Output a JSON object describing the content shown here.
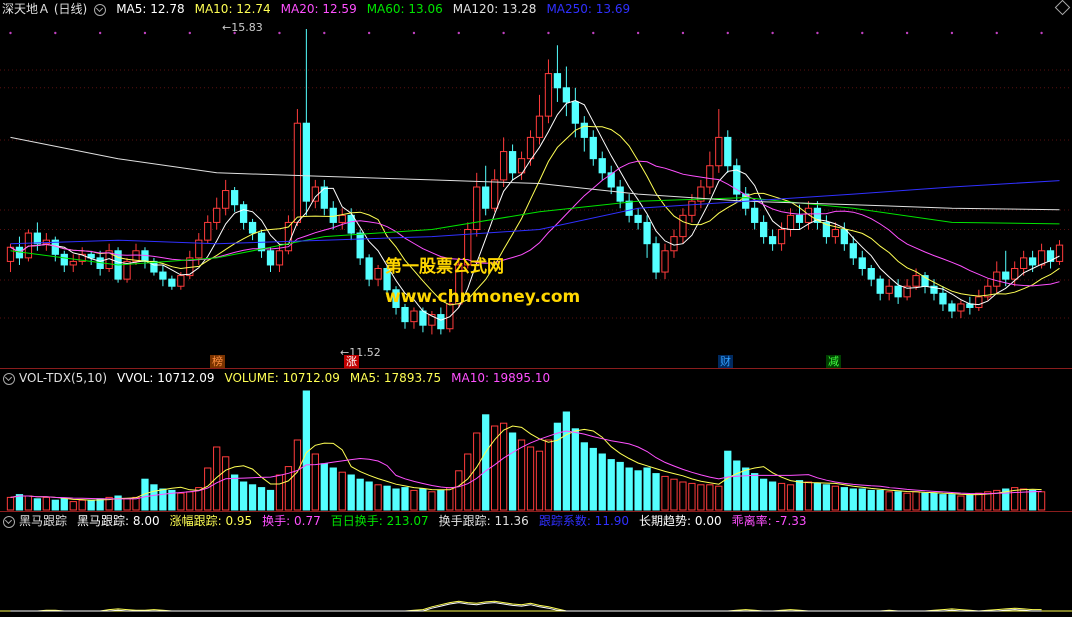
{
  "main": {
    "title": "深天地Ａ (日线)",
    "ma": [
      {
        "label": "MA5: 12.78",
        "color": "#ffffff"
      },
      {
        "label": "MA10: 12.74",
        "color": "#ffff54"
      },
      {
        "label": "MA20: 12.59",
        "color": "#ff50ff"
      },
      {
        "label": "MA60: 13.06",
        "color": "#00e400"
      },
      {
        "label": "MA120: 13.28",
        "color": "#e0e0e0"
      },
      {
        "label": "MA250: 13.69",
        "color": "#3030ff"
      }
    ],
    "high_label": "15.83",
    "low_label": "11.52",
    "watermark_line1": "第一股票公式网",
    "watermark_line2": "www.chnmoney.com",
    "markers": [
      {
        "text": "榜",
        "color": "#ff9040",
        "bg": "#7a3300"
      },
      {
        "text": "涨",
        "color": "#ffffff",
        "bg": "#c00000"
      },
      {
        "text": "财",
        "color": "#30a0ff",
        "bg": "#002a60"
      },
      {
        "text": "减",
        "color": "#40ff40",
        "bg": "#004000"
      }
    ]
  },
  "volume": {
    "title": "VOL-TDX(5,10)",
    "items": [
      {
        "label": "VVOL: 10712.09",
        "color": "#ffffff"
      },
      {
        "label": "VOLUME: 10712.09",
        "color": "#ffff54"
      },
      {
        "label": "MA5: 17893.75",
        "color": "#ffff54"
      },
      {
        "label": "MA10: 19895.10",
        "color": "#ff50ff"
      }
    ]
  },
  "indicator": {
    "title": "黑马跟踪",
    "items": [
      {
        "label": "黑马跟踪: 8.00",
        "color": "#ffffff"
      },
      {
        "label": "涨幅跟踪: 0.95",
        "color": "#ffff54"
      },
      {
        "label": "换手: 0.77",
        "color": "#ff50ff"
      },
      {
        "label": "百日换手: 213.07",
        "color": "#00e400"
      },
      {
        "label": "换手跟踪: 11.36",
        "color": "#e0e0e0"
      },
      {
        "label": "跟踪系数: 11.90",
        "color": "#3030ff"
      },
      {
        "label": "长期趋势: 0.00",
        "color": "#ffffff"
      },
      {
        "label": "乖离率: -7.33",
        "color": "#ff50ff"
      }
    ]
  },
  "chart_data": {
    "type": "candlestick",
    "price_range": [
      11.3,
      15.9
    ],
    "candles": [
      [
        12.55,
        12.75,
        12.4,
        12.8
      ],
      [
        12.75,
        12.6,
        12.5,
        12.9
      ],
      [
        12.6,
        12.95,
        12.55,
        13.0
      ],
      [
        12.95,
        12.8,
        12.7,
        13.1
      ],
      [
        12.8,
        12.85,
        12.7,
        12.95
      ],
      [
        12.85,
        12.65,
        12.55,
        12.9
      ],
      [
        12.65,
        12.5,
        12.4,
        12.7
      ],
      [
        12.5,
        12.55,
        12.4,
        12.65
      ],
      [
        12.55,
        12.65,
        12.5,
        12.75
      ],
      [
        12.65,
        12.6,
        12.5,
        12.7
      ],
      [
        12.6,
        12.45,
        12.35,
        12.7
      ],
      [
        12.45,
        12.7,
        12.4,
        12.8
      ],
      [
        12.7,
        12.3,
        12.25,
        12.75
      ],
      [
        12.3,
        12.55,
        12.25,
        12.6
      ],
      [
        12.55,
        12.7,
        12.5,
        12.8
      ],
      [
        12.7,
        12.55,
        12.45,
        12.75
      ],
      [
        12.55,
        12.4,
        12.35,
        12.6
      ],
      [
        12.4,
        12.3,
        12.2,
        12.5
      ],
      [
        12.3,
        12.2,
        12.15,
        12.35
      ],
      [
        12.2,
        12.35,
        12.15,
        12.4
      ],
      [
        12.35,
        12.6,
        12.3,
        12.7
      ],
      [
        12.6,
        12.85,
        12.5,
        12.95
      ],
      [
        12.85,
        13.1,
        12.8,
        13.2
      ],
      [
        13.1,
        13.3,
        13.0,
        13.45
      ],
      [
        13.3,
        13.55,
        13.2,
        13.7
      ],
      [
        13.55,
        13.35,
        13.25,
        13.6
      ],
      [
        13.35,
        13.1,
        13.0,
        13.4
      ],
      [
        13.1,
        12.95,
        12.85,
        13.15
      ],
      [
        12.95,
        12.7,
        12.6,
        13.0
      ],
      [
        12.7,
        12.5,
        12.4,
        12.75
      ],
      [
        12.5,
        12.7,
        12.4,
        12.8
      ],
      [
        12.7,
        13.1,
        12.65,
        13.2
      ],
      [
        13.1,
        14.5,
        13.05,
        14.7
      ],
      [
        14.5,
        13.4,
        13.2,
        15.83
      ],
      [
        13.4,
        13.6,
        13.3,
        13.7
      ],
      [
        13.6,
        13.3,
        13.2,
        13.7
      ],
      [
        13.3,
        13.1,
        13.0,
        13.4
      ],
      [
        13.1,
        13.2,
        13.0,
        13.3
      ],
      [
        13.2,
        12.95,
        12.85,
        13.3
      ],
      [
        12.95,
        12.6,
        12.5,
        13.0
      ],
      [
        12.6,
        12.3,
        12.2,
        12.65
      ],
      [
        12.3,
        12.45,
        12.2,
        12.5
      ],
      [
        12.45,
        12.15,
        12.05,
        12.5
      ],
      [
        12.15,
        11.9,
        11.8,
        12.2
      ],
      [
        11.9,
        11.7,
        11.6,
        11.95
      ],
      [
        11.7,
        11.85,
        11.6,
        11.9
      ],
      [
        11.85,
        11.65,
        11.55,
        11.9
      ],
      [
        11.65,
        11.8,
        11.52,
        11.85
      ],
      [
        11.8,
        11.6,
        11.52,
        11.9
      ],
      [
        11.6,
        11.95,
        11.55,
        12.05
      ],
      [
        11.95,
        12.5,
        11.9,
        12.6
      ],
      [
        12.5,
        13.0,
        12.45,
        13.1
      ],
      [
        13.0,
        13.6,
        12.9,
        13.8
      ],
      [
        13.6,
        13.3,
        13.2,
        13.9
      ],
      [
        13.3,
        13.7,
        13.25,
        13.85
      ],
      [
        13.7,
        14.1,
        13.6,
        14.3
      ],
      [
        14.1,
        13.8,
        13.7,
        14.2
      ],
      [
        13.8,
        14.0,
        13.7,
        14.1
      ],
      [
        14.0,
        14.3,
        13.9,
        14.4
      ],
      [
        14.3,
        14.6,
        14.2,
        14.9
      ],
      [
        14.6,
        15.2,
        14.5,
        15.4
      ],
      [
        15.2,
        15.0,
        14.8,
        15.6
      ],
      [
        15.0,
        14.8,
        14.6,
        15.3
      ],
      [
        14.8,
        14.5,
        14.3,
        15.0
      ],
      [
        14.5,
        14.3,
        14.1,
        14.6
      ],
      [
        14.3,
        14.0,
        13.9,
        14.4
      ],
      [
        14.0,
        13.8,
        13.7,
        14.1
      ],
      [
        13.8,
        13.6,
        13.5,
        13.9
      ],
      [
        13.6,
        13.4,
        13.3,
        13.7
      ],
      [
        13.4,
        13.2,
        13.1,
        13.5
      ],
      [
        13.2,
        13.1,
        13.0,
        13.3
      ],
      [
        13.1,
        12.8,
        12.6,
        13.2
      ],
      [
        12.8,
        12.4,
        12.3,
        12.9
      ],
      [
        12.4,
        12.7,
        12.3,
        12.8
      ],
      [
        12.7,
        12.9,
        12.6,
        13.0
      ],
      [
        12.9,
        13.2,
        12.8,
        13.3
      ],
      [
        13.2,
        13.4,
        13.1,
        13.5
      ],
      [
        13.4,
        13.6,
        13.3,
        13.7
      ],
      [
        13.6,
        13.9,
        13.5,
        14.1
      ],
      [
        13.9,
        14.3,
        13.8,
        14.7
      ],
      [
        14.3,
        13.9,
        13.8,
        14.4
      ],
      [
        13.9,
        13.5,
        13.4,
        14.0
      ],
      [
        13.5,
        13.3,
        13.2,
        13.6
      ],
      [
        13.3,
        13.1,
        13.0,
        13.4
      ],
      [
        13.1,
        12.9,
        12.8,
        13.2
      ],
      [
        12.9,
        12.8,
        12.7,
        13.0
      ],
      [
        12.8,
        13.0,
        12.7,
        13.1
      ],
      [
        13.0,
        13.2,
        12.9,
        13.3
      ],
      [
        13.2,
        13.1,
        13.0,
        13.35
      ],
      [
        13.1,
        13.3,
        13.0,
        13.4
      ],
      [
        13.3,
        13.1,
        13.0,
        13.4
      ],
      [
        13.1,
        12.9,
        12.8,
        13.2
      ],
      [
        12.9,
        13.0,
        12.8,
        13.1
      ],
      [
        13.0,
        12.8,
        12.7,
        13.1
      ],
      [
        12.8,
        12.6,
        12.5,
        12.9
      ],
      [
        12.6,
        12.45,
        12.35,
        12.7
      ],
      [
        12.45,
        12.3,
        12.2,
        12.5
      ],
      [
        12.3,
        12.1,
        12.0,
        12.35
      ],
      [
        12.1,
        12.2,
        12.0,
        12.3
      ],
      [
        12.2,
        12.05,
        11.95,
        12.3
      ],
      [
        12.05,
        12.2,
        12.0,
        12.3
      ],
      [
        12.2,
        12.35,
        12.15,
        12.45
      ],
      [
        12.35,
        12.2,
        12.1,
        12.4
      ],
      [
        12.2,
        12.1,
        12.0,
        12.3
      ],
      [
        12.1,
        11.95,
        11.85,
        12.2
      ],
      [
        11.95,
        11.85,
        11.75,
        12.0
      ],
      [
        11.85,
        11.95,
        11.75,
        12.0
      ],
      [
        11.95,
        11.9,
        11.8,
        12.05
      ],
      [
        11.9,
        12.05,
        11.85,
        12.15
      ],
      [
        12.05,
        12.2,
        12.0,
        12.3
      ],
      [
        12.2,
        12.4,
        12.1,
        12.55
      ],
      [
        12.4,
        12.3,
        12.2,
        12.7
      ],
      [
        12.3,
        12.45,
        12.2,
        12.55
      ],
      [
        12.45,
        12.6,
        12.35,
        12.7
      ],
      [
        12.6,
        12.5,
        12.4,
        12.7
      ],
      [
        12.5,
        12.7,
        12.45,
        12.8
      ],
      [
        12.7,
        12.55,
        12.45,
        12.75
      ],
      [
        12.55,
        12.78,
        12.5,
        12.85
      ]
    ],
    "volume": [
      9,
      11,
      10,
      8,
      9,
      7,
      8,
      6,
      7,
      7,
      8,
      9,
      10,
      8,
      9,
      22,
      18,
      15,
      14,
      12,
      13,
      16,
      30,
      45,
      38,
      25,
      20,
      18,
      16,
      14,
      25,
      31,
      50,
      85,
      40,
      33,
      30,
      27,
      25,
      22,
      20,
      18,
      17,
      15,
      16,
      14,
      15,
      13,
      14,
      16,
      28,
      40,
      55,
      68,
      60,
      62,
      55,
      50,
      45,
      42,
      50,
      62,
      70,
      58,
      48,
      44,
      40,
      36,
      34,
      30,
      28,
      30,
      26,
      24,
      22,
      20,
      19,
      18,
      18,
      17,
      42,
      35,
      30,
      26,
      22,
      20,
      19,
      18,
      21,
      20,
      19,
      18,
      17,
      16,
      15,
      15,
      14,
      14,
      13,
      13,
      12,
      13,
      12,
      12,
      11,
      11,
      10,
      11,
      12,
      13,
      14,
      15,
      16,
      15,
      14,
      13
    ]
  }
}
